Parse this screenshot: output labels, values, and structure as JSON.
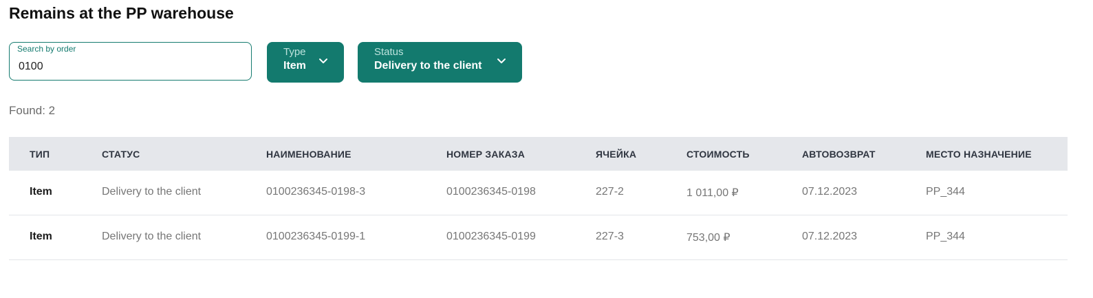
{
  "page": {
    "title": "Remains at the PP warehouse"
  },
  "search": {
    "label": "Search by order",
    "value": "0100"
  },
  "filters": {
    "type": {
      "label": "Type",
      "value": "Item",
      "icon": "chevron-down-icon"
    },
    "status": {
      "label": "Status",
      "value": "Delivery to the client",
      "icon": "chevron-down-icon"
    }
  },
  "results": {
    "found_text": "Found: 2"
  },
  "table": {
    "columns": [
      "ТИП",
      "СТАТУС",
      "НАИМЕНОВАНИЕ",
      "НОМЕР ЗАКАЗА",
      "ЯЧЕЙКА",
      "СТОИМОСТЬ",
      "АВТОВОЗВРАТ",
      "МЕСТО НАЗНАЧЕНИЕ"
    ],
    "rows": [
      [
        "Item",
        "Delivery to the client",
        "0100236345-0198-3",
        "0100236345-0198",
        "227-2",
        "1 011,00 ₽",
        "07.12.2023",
        "PP_344"
      ],
      [
        "Item",
        "Delivery to the client",
        "0100236345-0199-1",
        "0100236345-0199",
        "227-3",
        "753,00 ₽",
        "07.12.2023",
        "PP_344"
      ]
    ]
  },
  "colors": {
    "accent": "#137a6e",
    "header_bg": "#e5e7eb"
  }
}
